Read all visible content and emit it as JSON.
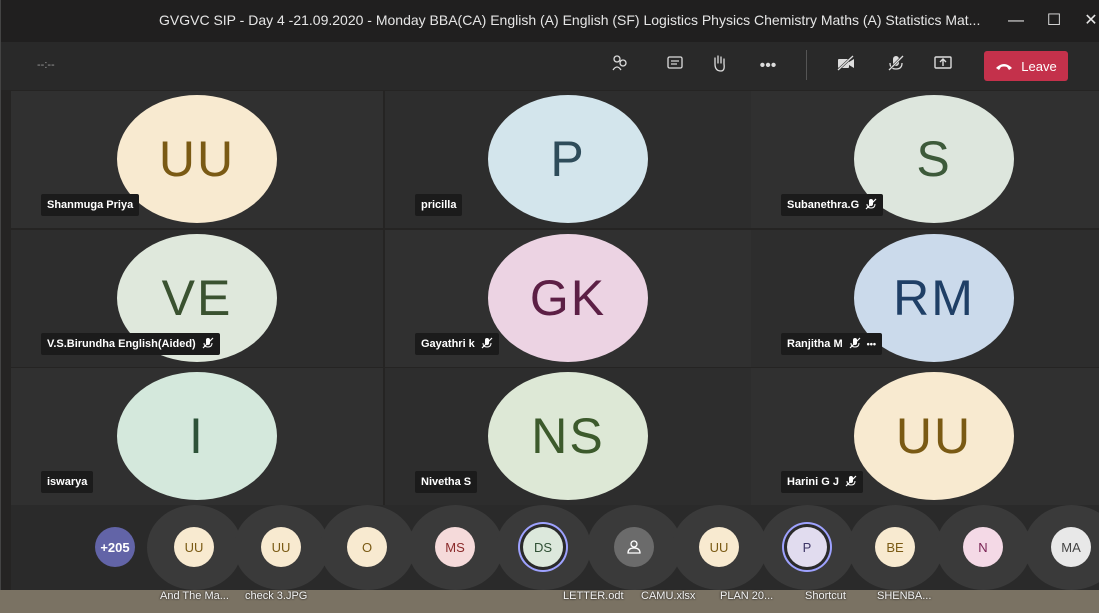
{
  "window": {
    "title": "GVGVC SIP - Day 4 -21.09.2020 - Monday BBA(CA) English (A) English (SF) Logistics Physics Chemistry Maths (A) Statistics Mat...",
    "minimize": "—",
    "maximize": "☐",
    "close": "✕"
  },
  "toolbar": {
    "timer": "--:--",
    "leave_label": "Leave",
    "icons": [
      "people-icon",
      "chat-icon",
      "raise-hand-icon",
      "more-icon",
      "camera-off-icon",
      "mic-off-icon",
      "share-screen-icon"
    ]
  },
  "participants": [
    {
      "name": "Shanmuga Priya",
      "initials": "UU",
      "bg": "#f8ead0",
      "fg": "#7a5a14",
      "muted": false,
      "more": false
    },
    {
      "name": "pricilla",
      "initials": "P",
      "bg": "#d3e5ec",
      "fg": "#2e4c5a",
      "muted": false,
      "more": false
    },
    {
      "name": "Subanethra.G",
      "initials": "S",
      "bg": "#dde6dd",
      "fg": "#3d5a3a",
      "muted": true,
      "more": false
    },
    {
      "name": "V.S.Birundha English(Aided)",
      "initials": "VE",
      "bg": "#dfe8dc",
      "fg": "#3a5230",
      "muted": true,
      "more": false
    },
    {
      "name": "Gayathri k",
      "initials": "GK",
      "bg": "#ecd3e3",
      "fg": "#5c1f45",
      "muted": true,
      "more": false
    },
    {
      "name": "Ranjitha M",
      "initials": "RM",
      "bg": "#cbdaeb",
      "fg": "#1f3f66",
      "muted": true,
      "more": true
    },
    {
      "name": "iswarya",
      "initials": "I",
      "bg": "#d4e8dc",
      "fg": "#2d5238",
      "muted": false,
      "more": false
    },
    {
      "name": "Nivetha S",
      "initials": "NS",
      "bg": "#dde8d6",
      "fg": "#3c5a2c",
      "muted": false,
      "more": false
    },
    {
      "name": "Harini G J",
      "initials": "UU",
      "bg": "#f8ead0",
      "fg": "#7a5a14",
      "muted": true,
      "more": false
    }
  ],
  "bottom_strip": {
    "overflow": "+205",
    "chips": [
      {
        "initials": "UU",
        "bg": "#f8ead0",
        "fg": "#7a5a14"
      },
      {
        "initials": "UU",
        "bg": "#f8ead0",
        "fg": "#7a5a14"
      },
      {
        "initials": "O",
        "bg": "#f8ead0",
        "fg": "#7a5a14"
      },
      {
        "initials": "MS",
        "bg": "#f5dada",
        "fg": "#8a2a2a"
      },
      {
        "initials": "DS",
        "bg": "#dce8dc",
        "fg": "#2f4f34",
        "ring": true
      },
      {
        "initials": "",
        "bg": "#6b6b6b",
        "fg": "#ffffff",
        "icon": true
      },
      {
        "initials": "UU",
        "bg": "#f8ead0",
        "fg": "#7a5a14"
      },
      {
        "initials": "P",
        "bg": "#e1dcef",
        "fg": "#3d3566",
        "ring": true
      },
      {
        "initials": "BE",
        "bg": "#f8ead0",
        "fg": "#7a5a14"
      },
      {
        "initials": "N",
        "bg": "#f4d9e6",
        "fg": "#7a2455"
      },
      {
        "initials": "MA",
        "bg": "#e8e8e8",
        "fg": "#444444"
      }
    ]
  },
  "desktop_icons": [
    "And The Ma...",
    "check 3.JPG",
    "LETTER.odt",
    "CAMU.xlsx",
    "PLAN 20...",
    "Shortcut",
    "SHENBA..."
  ],
  "colors": {
    "accent": "#6264a7",
    "leave": "#c4314b"
  }
}
